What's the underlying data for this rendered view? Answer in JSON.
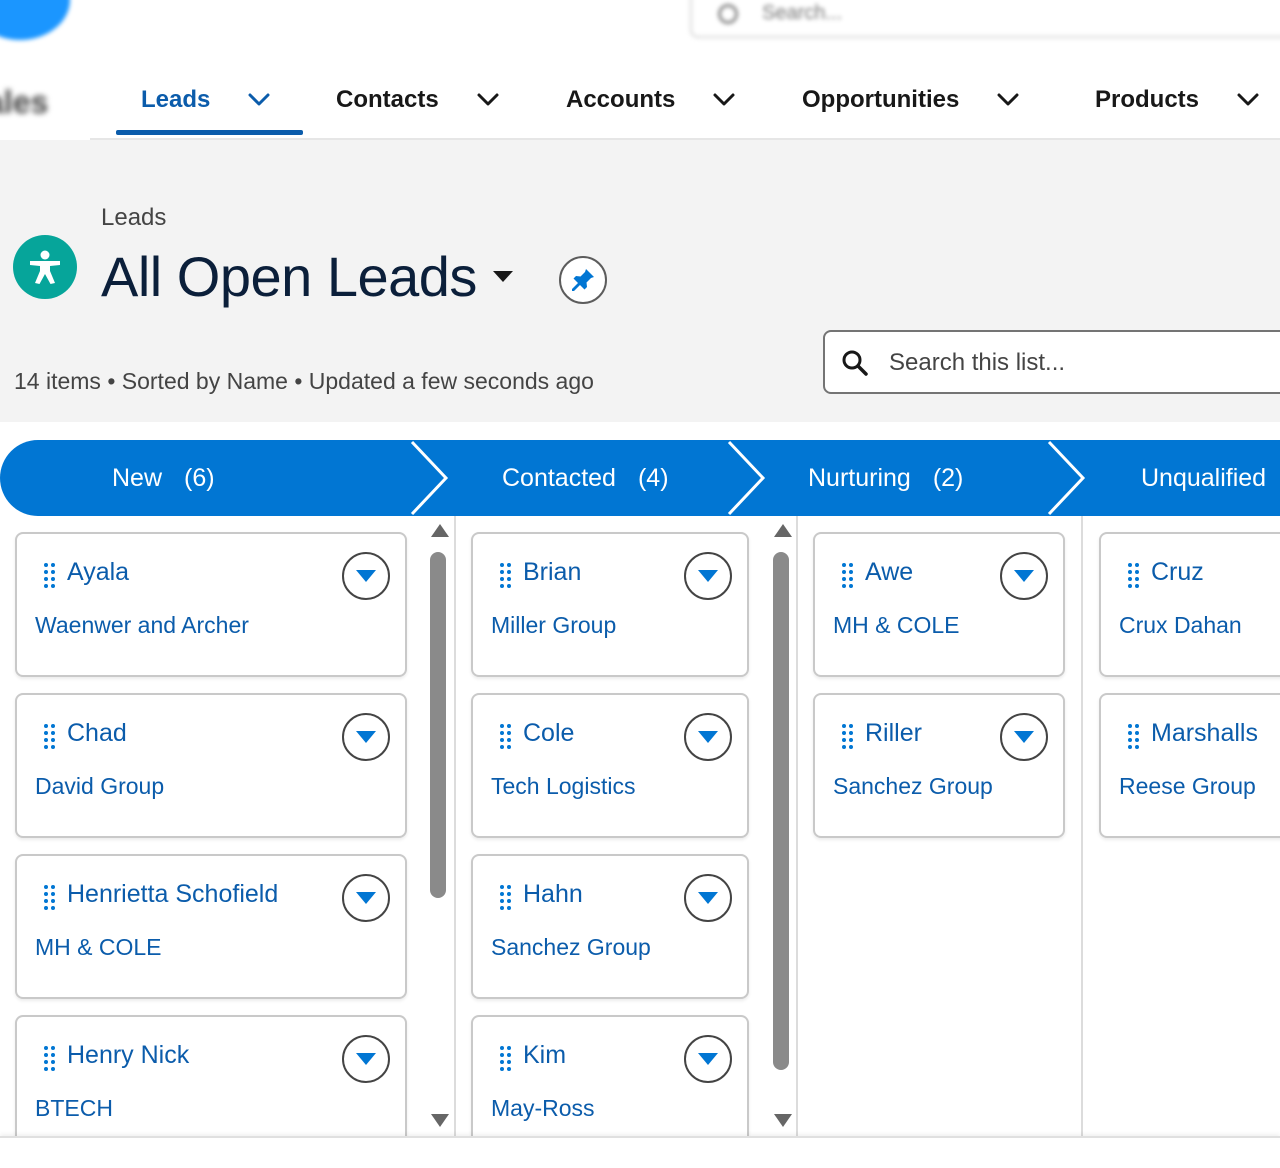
{
  "header": {
    "search_placeholder": "Search...",
    "app_name": "ales"
  },
  "nav": {
    "tabs": [
      {
        "label": "Leads",
        "active": true
      },
      {
        "label": "Contacts",
        "active": false
      },
      {
        "label": "Accounts",
        "active": false
      },
      {
        "label": "Opportunities",
        "active": false
      },
      {
        "label": "Products",
        "active": false
      }
    ]
  },
  "list_header": {
    "breadcrumb": "Leads",
    "title": "All Open Leads",
    "meta": "14 items • Sorted by Name • Updated a few seconds ago",
    "search_placeholder": "Search this list...",
    "object_icon": "lead-icon",
    "pin_icon": "pin-icon"
  },
  "colors": {
    "brand": "#0176d3",
    "link": "#0b5cab",
    "lead_icon_bg": "#06a59a"
  },
  "stages": [
    {
      "label": "New",
      "count": "(6)"
    },
    {
      "label": "Contacted",
      "count": "(4)"
    },
    {
      "label": "Nurturing",
      "count": "(2)"
    },
    {
      "label": "Unqualified",
      "count": ""
    }
  ],
  "columns": [
    {
      "cards": [
        {
          "name": "Ayala",
          "company": "Waenwer and Archer"
        },
        {
          "name": "Chad",
          "company": "David Group"
        },
        {
          "name": "Henrietta Schofield",
          "company": "MH & COLE"
        },
        {
          "name": "Henry Nick",
          "company": "BTECH"
        }
      ]
    },
    {
      "cards": [
        {
          "name": "Brian",
          "company": "Miller Group"
        },
        {
          "name": "Cole",
          "company": "Tech Logistics"
        },
        {
          "name": "Hahn",
          "company": "Sanchez Group"
        },
        {
          "name": "Kim",
          "company": "May-Ross"
        }
      ]
    },
    {
      "cards": [
        {
          "name": "Awe",
          "company": "MH & COLE"
        },
        {
          "name": "Riller",
          "company": "Sanchez Group"
        }
      ]
    },
    {
      "cards": [
        {
          "name": "Cruz",
          "company": "Crux Dahan"
        },
        {
          "name": "Marshalls",
          "company": "Reese Group"
        }
      ]
    }
  ]
}
